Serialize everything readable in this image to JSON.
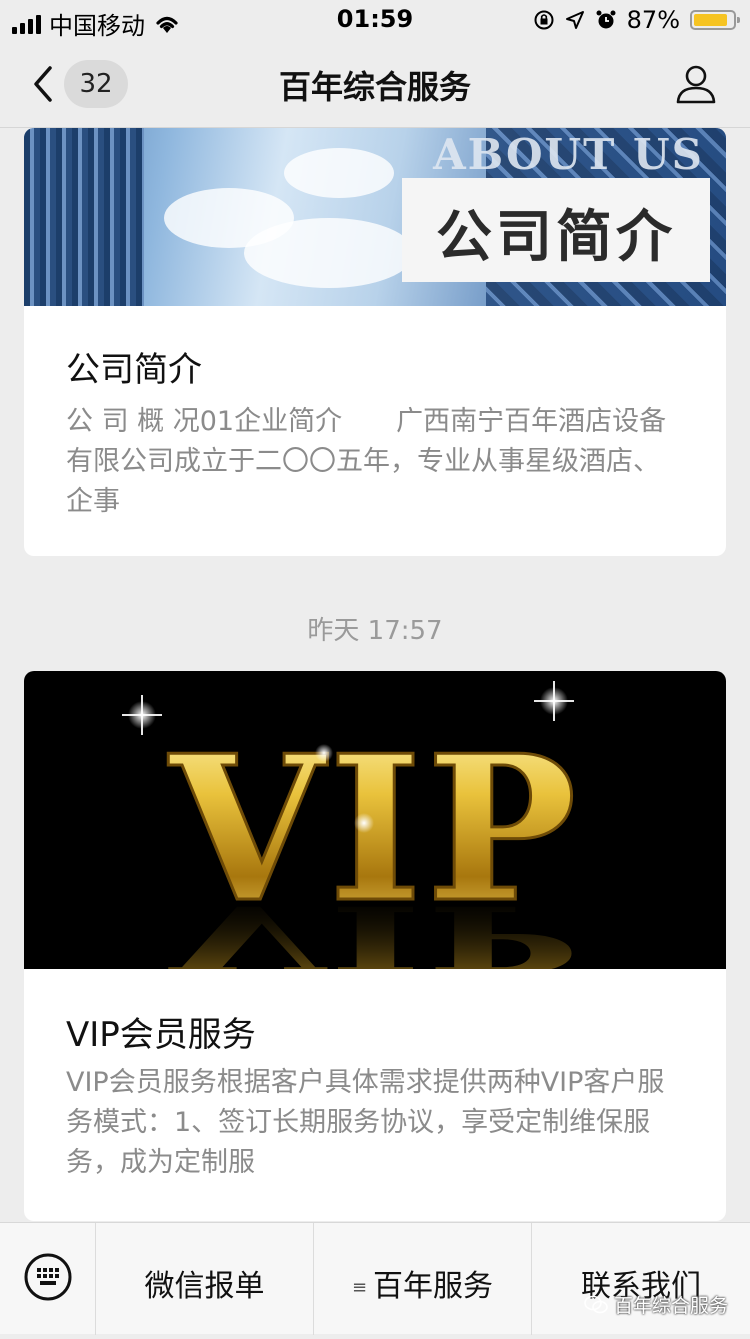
{
  "status_bar": {
    "carrier": "中国移动",
    "time": "01:59",
    "battery_percent": "87%",
    "battery_level": 0.87,
    "icons": [
      "signal-icon",
      "wifi-icon",
      "orientation-lock-icon",
      "location-arrow-icon",
      "alarm-icon",
      "battery-icon"
    ]
  },
  "nav": {
    "back_icon": "chevron-left-icon",
    "unread_count": "32",
    "title": "百年综合服务",
    "profile_icon": "person-icon"
  },
  "articles": [
    {
      "banner": {
        "overlay_en": "ABOUT US",
        "overlay_cn": "公司简介"
      },
      "title": "公司简介",
      "desc": "公 司 概 况01企业简介　　广西南宁百年酒店设备有限公司成立于二〇〇五年，专业从事星级酒店、企事"
    },
    {
      "banner": {
        "text": "VIP"
      },
      "title": "VIP会员服务",
      "desc": "VIP会员服务根据客户具体需求提供两种VIP客户服务模式：1、签订长期服务协议，享受定制维保服务，成为定制服"
    }
  ],
  "timestamp": "昨天 17:57",
  "bottom_menu": {
    "keyboard_icon": "keyboard-icon",
    "items": [
      {
        "label": "微信报单"
      },
      {
        "label": "百年服务",
        "has_submenu": true
      },
      {
        "label": "联系我们"
      }
    ],
    "watermark": "百年综合服务"
  },
  "colors": {
    "background": "#ededed",
    "battery": "#f6c423",
    "text_secondary": "#8b8b8b"
  }
}
